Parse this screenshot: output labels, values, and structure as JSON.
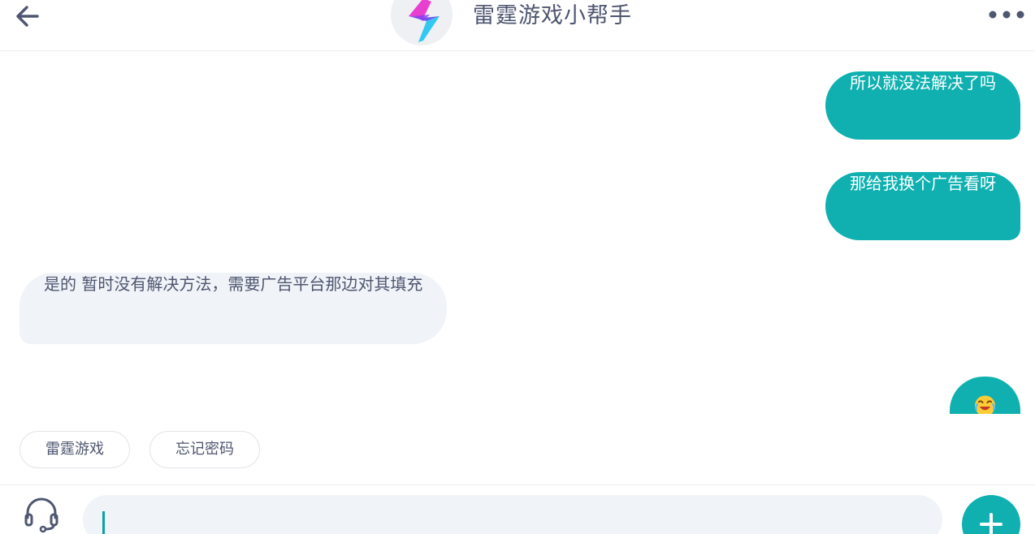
{
  "header": {
    "title": "雷霆游戏小帮手",
    "back_icon": "arrow-left-icon",
    "more_icon": "more-dots-icon",
    "avatar_icon": "lightning-logo-icon"
  },
  "messages": [
    {
      "side": "right",
      "text": "所以就没法解决了吗"
    },
    {
      "side": "right",
      "text": "那给我换个广告看呀"
    },
    {
      "side": "left",
      "text": "是的 暂时没有解决方法，需要广告平台那边对其填充"
    },
    {
      "side": "right",
      "type": "emoji",
      "icon": "laughing-crying-emoji-icon"
    }
  ],
  "quick_replies": [
    "雷霆游戏",
    "忘记密码"
  ],
  "input": {
    "value": "",
    "placeholder": "",
    "headset_icon": "headset-icon",
    "add_icon": "plus-icon"
  },
  "colors": {
    "accent": "#10b0b0",
    "bubble_left_bg": "#f0f3f7",
    "text_dark": "#4e5670"
  }
}
